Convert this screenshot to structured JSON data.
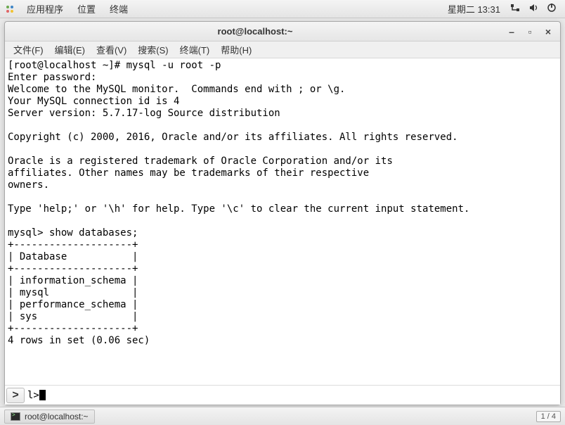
{
  "top_panel": {
    "menus": [
      "应用程序",
      "位置",
      "终端"
    ],
    "clock": "星期二 13:31"
  },
  "window": {
    "title": "root@localhost:~"
  },
  "menubar": {
    "items": [
      "文件(F)",
      "编辑(E)",
      "查看(V)",
      "搜索(S)",
      "终端(T)",
      "帮助(H)"
    ]
  },
  "terminal": {
    "lines": [
      "[root@localhost ~]# mysql -u root -p",
      "Enter password:",
      "Welcome to the MySQL monitor.  Commands end with ; or \\g.",
      "Your MySQL connection id is 4",
      "Server version: 5.7.17-log Source distribution",
      "",
      "Copyright (c) 2000, 2016, Oracle and/or its affiliates. All rights reserved.",
      "",
      "Oracle is a registered trademark of Oracle Corporation and/or its",
      "affiliates. Other names may be trademarks of their respective",
      "owners.",
      "",
      "Type 'help;' or '\\h' for help. Type '\\c' to clear the current input statement.",
      "",
      "mysql> show databases;",
      "+--------------------+",
      "| Database           |",
      "+--------------------+",
      "| information_schema |",
      "| mysql              |",
      "| performance_schema |",
      "| sys                |",
      "+--------------------+",
      "4 rows in set (0.06 sec)",
      ""
    ],
    "prompt_tail": "l> "
  },
  "taskbar": {
    "task_label": "root@localhost:~",
    "workspace": "1 / 4"
  }
}
